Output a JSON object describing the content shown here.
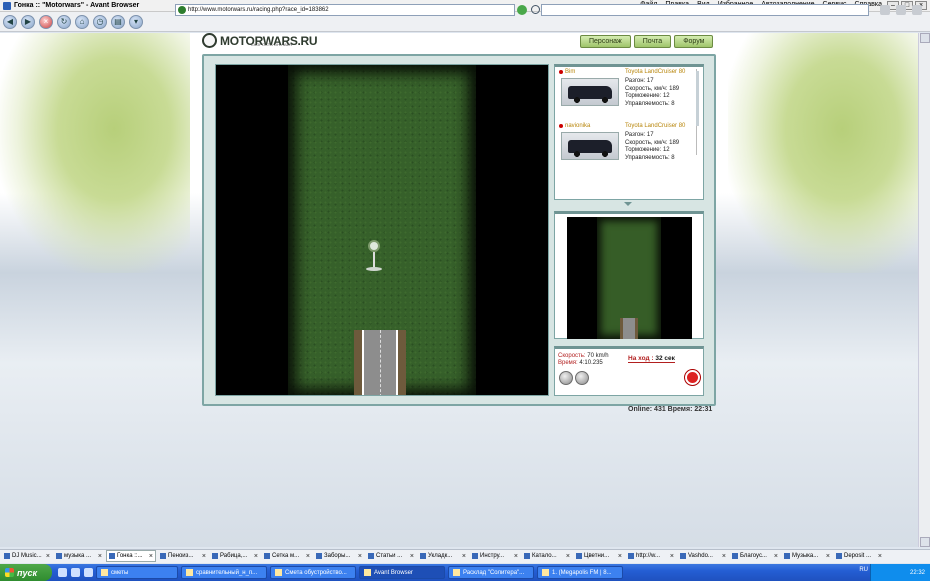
{
  "window": {
    "title": "Гонка :: \"Motorwars\" - Avant Browser",
    "menu": [
      "Файл",
      "Правка",
      "Вид",
      "Избранное",
      "Автозаполнение",
      "Сервис",
      "Справка"
    ]
  },
  "toolbar": {
    "address": "http://www.motorwars.ru/racing.php?race_id=183862"
  },
  "site": {
    "logo": "MOTORWARS.RU",
    "tagline": "СКОРОСТЬ ОН-ЛАЙН",
    "nav": [
      "Персонаж",
      "Почта",
      "Форум"
    ]
  },
  "players": [
    {
      "name": "Bim",
      "model": "Toyota LandCruiser 80",
      "stats": [
        "Разгон: 17",
        "Скорость, км/ч: 189",
        "Торможение: 12",
        "Управляемость: 8"
      ]
    },
    {
      "name": "navionika",
      "model": "Toyota LandCruiser 80",
      "stats": [
        "Разгон: 17",
        "Скорость, км/ч: 189",
        "Торможение: 12",
        "Управляемость: 8"
      ]
    }
  ],
  "status": {
    "speed_label": "Скорость:",
    "speed_value": "70 km/h",
    "time_label": "Время:",
    "time_value": "4:10.235",
    "turn_label": "На ход :",
    "turn_value": "32 сек"
  },
  "footer": {
    "online": "Online: 431  Время: 22:31"
  },
  "browser_tabs": [
    "DJ Music...",
    "музыка ...",
    "Гонка ::...",
    "Пеноиз...",
    "Рабица,...",
    "Сетка м...",
    "Заборы...",
    "Статьи ...",
    "Укладк...",
    "Инстру...",
    "Катало...",
    "Цветни...",
    "http://w...",
    "Vashdo...",
    "Благоус...",
    "Музыка...",
    "Deposit ..."
  ],
  "taskbar": {
    "start": "пуск",
    "tasks": [
      "сметы",
      "сравнительный_н_п...",
      "Смета обустройство...",
      "Avant Browser",
      "Расклад \"Солитера\"...",
      "1. (Megapolis FM | 8..."
    ],
    "lang": "RU",
    "clock": "22:32"
  }
}
